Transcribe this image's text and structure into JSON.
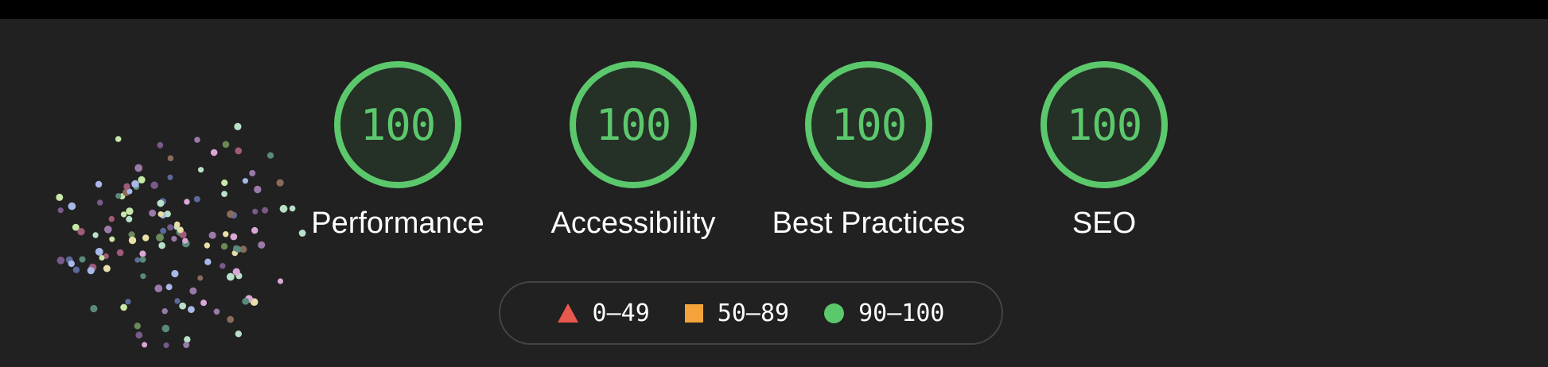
{
  "categories": [
    {
      "score": "100",
      "label": "Performance"
    },
    {
      "score": "100",
      "label": "Accessibility"
    },
    {
      "score": "100",
      "label": "Best Practices"
    },
    {
      "score": "100",
      "label": "SEO"
    }
  ],
  "legend": [
    {
      "icon": "triangle-icon",
      "range": "0–49",
      "color": "#e8584c"
    },
    {
      "icon": "square-icon",
      "range": "50–89",
      "color": "#f3a33a"
    },
    {
      "icon": "circle-icon",
      "range": "90–100",
      "color": "#5cc86c"
    }
  ],
  "colors": {
    "pass": "#5cc86c",
    "average": "#f3a33a",
    "fail": "#e8584c",
    "background": "#212121"
  }
}
